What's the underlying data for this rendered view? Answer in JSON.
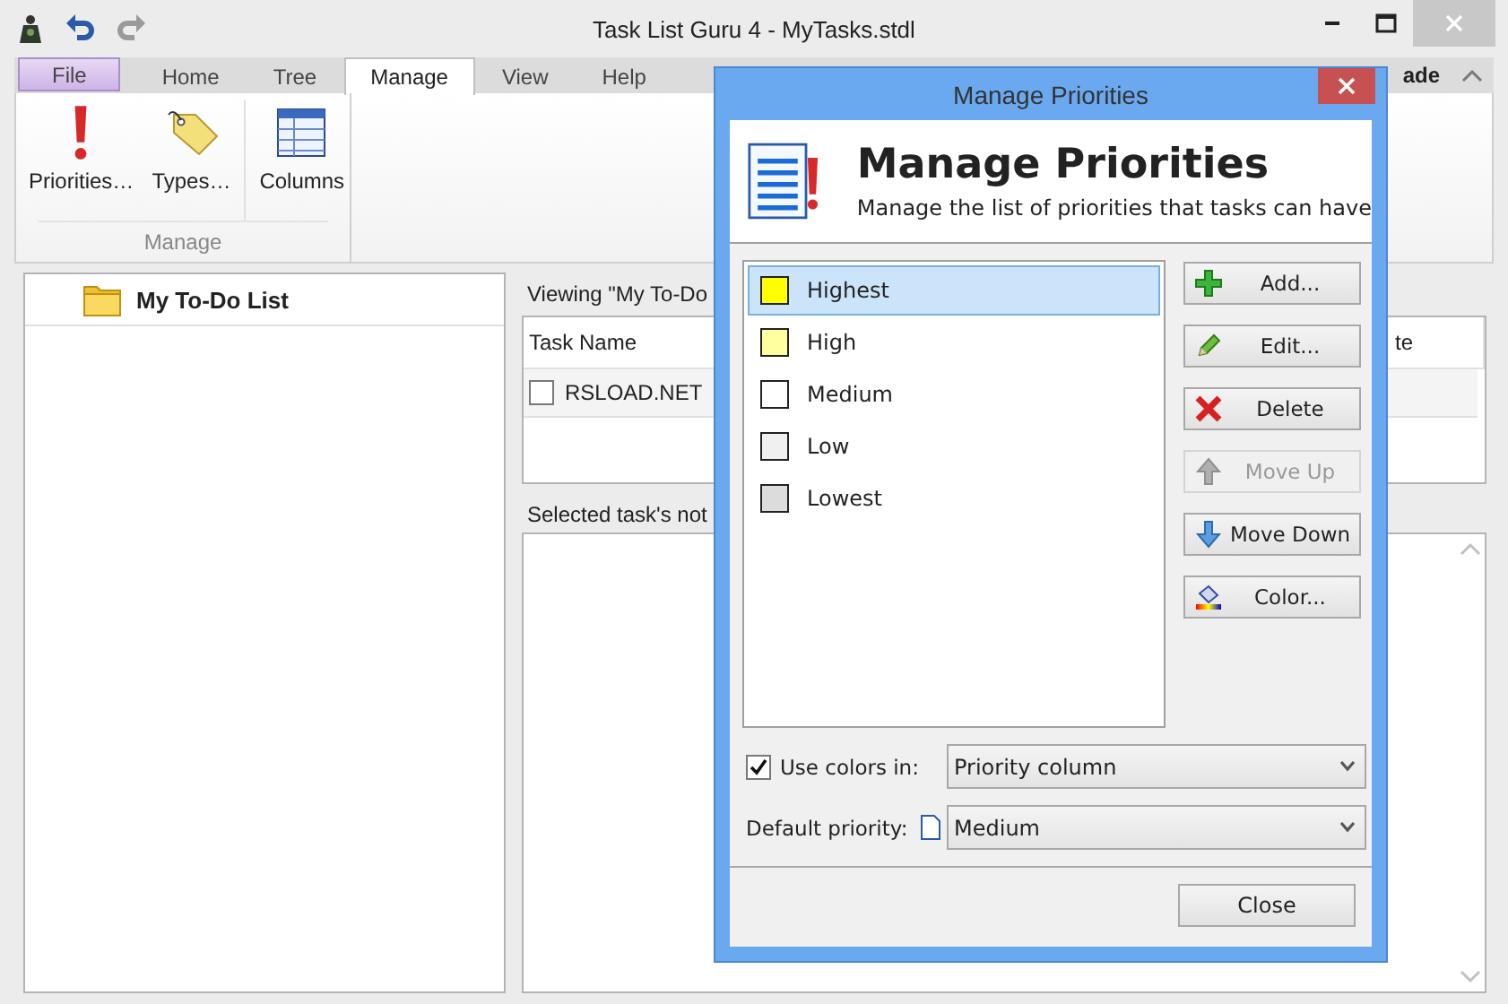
{
  "window": {
    "title": "Task List Guru 4 - MyTasks.stdl"
  },
  "ribbon_tabs": [
    {
      "label": "File",
      "kind": "file",
      "selected": false
    },
    {
      "label": "Home",
      "kind": "tab",
      "selected": false
    },
    {
      "label": "Tree",
      "kind": "tab",
      "selected": false
    },
    {
      "label": "Manage",
      "kind": "tab",
      "selected": true
    },
    {
      "label": "View",
      "kind": "tab",
      "selected": false
    },
    {
      "label": "Help",
      "kind": "tab",
      "selected": false
    }
  ],
  "ribbon_overflow": "ade",
  "ribbon_group": {
    "label": "Manage",
    "buttons": [
      {
        "label": "Priorities…",
        "kind": "priorities"
      },
      {
        "label": "Types…",
        "kind": "types"
      },
      {
        "label": "Columns",
        "kind": "columns"
      }
    ]
  },
  "tree": {
    "items": [
      {
        "label": "My To-Do List"
      }
    ]
  },
  "task_view": {
    "caption": "Viewing \"My To-Do",
    "columns": [
      "Task Name",
      "te"
    ],
    "rows": [
      {
        "name": "RSLOAD.NET",
        "checked": false
      }
    ],
    "notes_label": "Selected task's not"
  },
  "dialog": {
    "title": "Manage Priorities",
    "heading": "Manage Priorities",
    "subtitle": "Manage the list of priorities that tasks can have",
    "priorities": [
      {
        "name": "Highest",
        "color": "#ffff00",
        "selected": true
      },
      {
        "name": "High",
        "color": "#ffffa0",
        "selected": false
      },
      {
        "name": "Medium",
        "color": "#ffffff",
        "selected": false
      },
      {
        "name": "Low",
        "color": "#f0f0f0",
        "selected": false
      },
      {
        "name": "Lowest",
        "color": "#dcdcdc",
        "selected": false
      }
    ],
    "buttons": [
      {
        "label": "Add...",
        "kind": "add",
        "disabled": false
      },
      {
        "label": "Edit...",
        "kind": "edit",
        "disabled": false
      },
      {
        "label": "Delete",
        "kind": "delete",
        "disabled": false
      },
      {
        "label": "Move Up",
        "kind": "up",
        "disabled": true
      },
      {
        "label": "Move Down",
        "kind": "down",
        "disabled": false
      },
      {
        "label": "Color...",
        "kind": "color",
        "disabled": false
      }
    ],
    "use_colors": {
      "label": "Use colors in:",
      "checked": true,
      "value": "Priority column"
    },
    "default_priority": {
      "label": "Default priority:",
      "value": "Medium"
    },
    "close_button": "Close"
  }
}
